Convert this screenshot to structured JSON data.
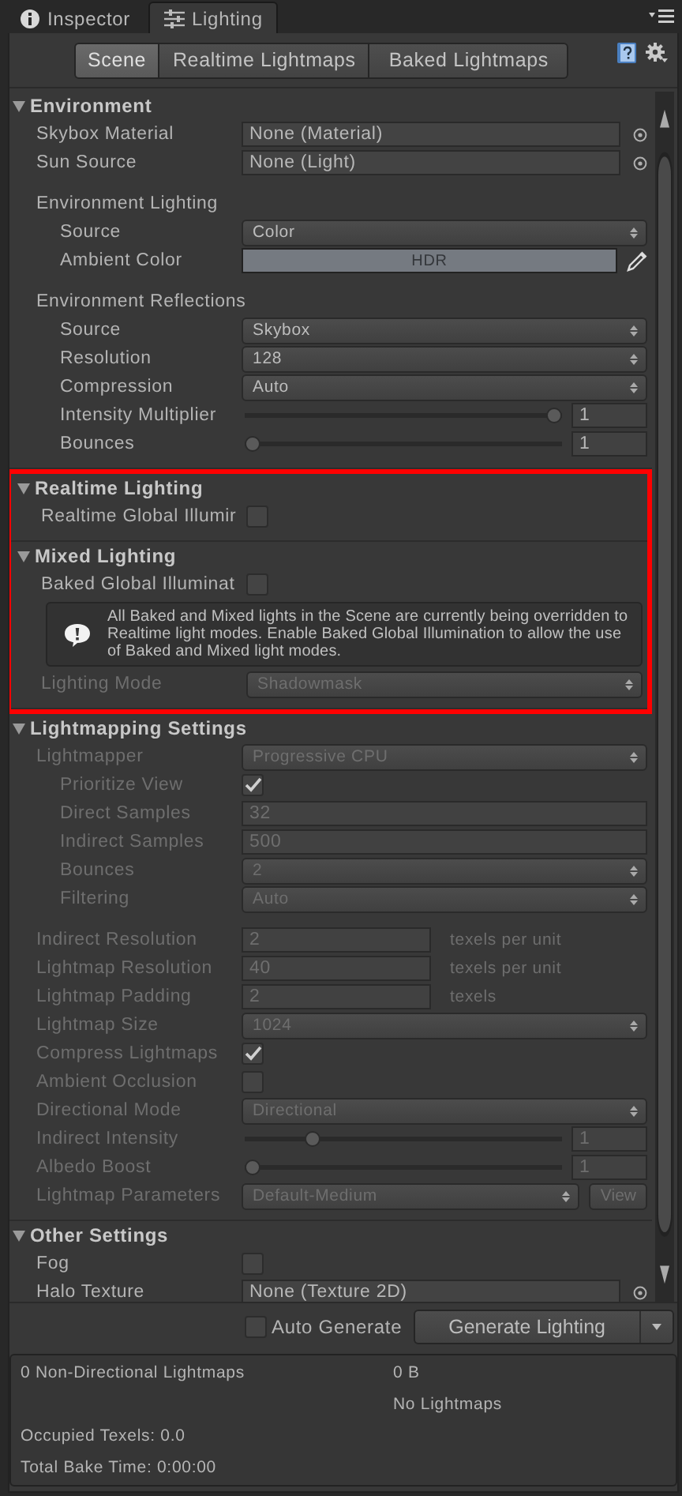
{
  "tabs": [
    {
      "label": "Inspector",
      "selected": false
    },
    {
      "label": "Lighting",
      "selected": true
    }
  ],
  "mode_tabs": [
    {
      "label": "Scene",
      "selected": true
    },
    {
      "label": "Realtime Lightmaps",
      "selected": false
    },
    {
      "label": "Baked Lightmaps",
      "selected": false
    }
  ],
  "sections": [
    {
      "title": "Environment",
      "expanded": true,
      "highlighted": false,
      "rows": [
        {
          "kind": "object",
          "label": "Skybox Material",
          "value": "None (Material)",
          "disabled": false
        },
        {
          "kind": "object",
          "label": "Sun Source",
          "value": "None (Light)",
          "disabled": false
        },
        {
          "kind": "heading",
          "label": "Environment Lighting",
          "disabled": false,
          "children": [
            {
              "kind": "dropdown",
              "label": "Source",
              "value": "Color",
              "disabled": false
            },
            {
              "kind": "color",
              "label": "Ambient Color",
              "value": "HDR",
              "color": "#757a81",
              "disabled": false
            }
          ]
        },
        {
          "kind": "heading",
          "label": "Environment Reflections",
          "disabled": false,
          "children": [
            {
              "kind": "dropdown",
              "label": "Source",
              "value": "Skybox",
              "disabled": false
            },
            {
              "kind": "dropdown",
              "label": "Resolution",
              "value": "128",
              "disabled": false
            },
            {
              "kind": "dropdown",
              "label": "Compression",
              "value": "Auto",
              "disabled": false
            },
            {
              "kind": "slider",
              "label": "Intensity Multiplier",
              "level": 1,
              "value": "1",
              "disabled": false
            },
            {
              "kind": "slider",
              "label": "Bounces",
              "level": 0,
              "value": "1",
              "disabled": false
            }
          ]
        }
      ]
    },
    {
      "title": "Realtime Lighting",
      "expanded": true,
      "highlighted": true,
      "rows": [
        {
          "kind": "checkbox",
          "label": "Realtime Global Illumir",
          "checked": false,
          "disabled": false
        }
      ]
    },
    {
      "title": "Mixed Lighting",
      "expanded": true,
      "highlighted": true,
      "rows": [
        {
          "kind": "checkbox",
          "label": "Baked Global Illuminat",
          "checked": false,
          "disabled": false
        },
        {
          "kind": "help",
          "text": "All Baked and Mixed lights in the Scene are currently being overridden to Realtime light modes. Enable Baked Global Illumination to allow the use of Baked and Mixed light modes.",
          "disabled": false
        },
        {
          "kind": "dropdown",
          "label": "Lighting Mode",
          "value": "Shadowmask",
          "disabled": true
        }
      ]
    },
    {
      "title": "Lightmapping Settings",
      "expanded": true,
      "highlighted": false,
      "rows": [
        {
          "kind": "dropdown",
          "label": "Lightmapper",
          "value": "Progressive CPU",
          "disabled": true,
          "children": [
            {
              "kind": "checkbox",
              "label": "Prioritize View",
              "checked": true,
              "disabled": true
            },
            {
              "kind": "number",
              "label": "Direct Samples",
              "value": "32",
              "disabled": true
            },
            {
              "kind": "number",
              "label": "Indirect Samples",
              "value": "500",
              "disabled": true
            },
            {
              "kind": "dropdown",
              "label": "Bounces",
              "value": "2",
              "disabled": true
            },
            {
              "kind": "dropdown",
              "label": "Filtering",
              "value": "Auto",
              "disabled": true
            }
          ]
        },
        {
          "kind": "number",
          "label": "Indirect Resolution",
          "value": "2",
          "unit": "texels per unit",
          "disabled": true
        },
        {
          "kind": "number",
          "label": "Lightmap Resolution",
          "value": "40",
          "unit": "texels per unit",
          "disabled": true
        },
        {
          "kind": "number",
          "label": "Lightmap Padding",
          "value": "2",
          "unit": "texels",
          "disabled": true
        },
        {
          "kind": "dropdown",
          "label": "Lightmap Size",
          "value": "1024",
          "disabled": true
        },
        {
          "kind": "checkbox",
          "label": "Compress Lightmaps",
          "checked": true,
          "disabled": true
        },
        {
          "kind": "checkbox",
          "label": "Ambient Occlusion",
          "checked": false,
          "disabled": true
        },
        {
          "kind": "dropdown",
          "label": "Directional Mode",
          "value": "Directional",
          "disabled": true
        },
        {
          "kind": "slider",
          "label": "Indirect Intensity",
          "level": 0.2,
          "value": "1",
          "disabled": true
        },
        {
          "kind": "slider",
          "label": "Albedo Boost",
          "level": 0,
          "value": "1",
          "disabled": true
        },
        {
          "kind": "dropdown",
          "label": "Lightmap Parameters",
          "value": "Default-Medium",
          "button": "View",
          "disabled": true
        }
      ]
    },
    {
      "title": "Other Settings",
      "expanded": true,
      "highlighted": false,
      "rows": [
        {
          "kind": "checkbox",
          "label": "Fog",
          "checked": false,
          "disabled": false
        },
        {
          "kind": "object",
          "label": "Halo Texture",
          "value": "None (Texture 2D)",
          "disabled": false
        }
      ]
    }
  ],
  "auto_generate": {
    "label": "Auto Generate",
    "checked": false
  },
  "generate_button": {
    "label": "Generate Lighting"
  },
  "stats": [
    {
      "left": "0 Non-Directional Lightmaps",
      "right": "0 B"
    },
    {
      "right": "No Lightmaps"
    },
    {
      "left": "Occupied Texels: 0.0"
    },
    {
      "left": "Total Bake Time: 0:00:00"
    }
  ]
}
